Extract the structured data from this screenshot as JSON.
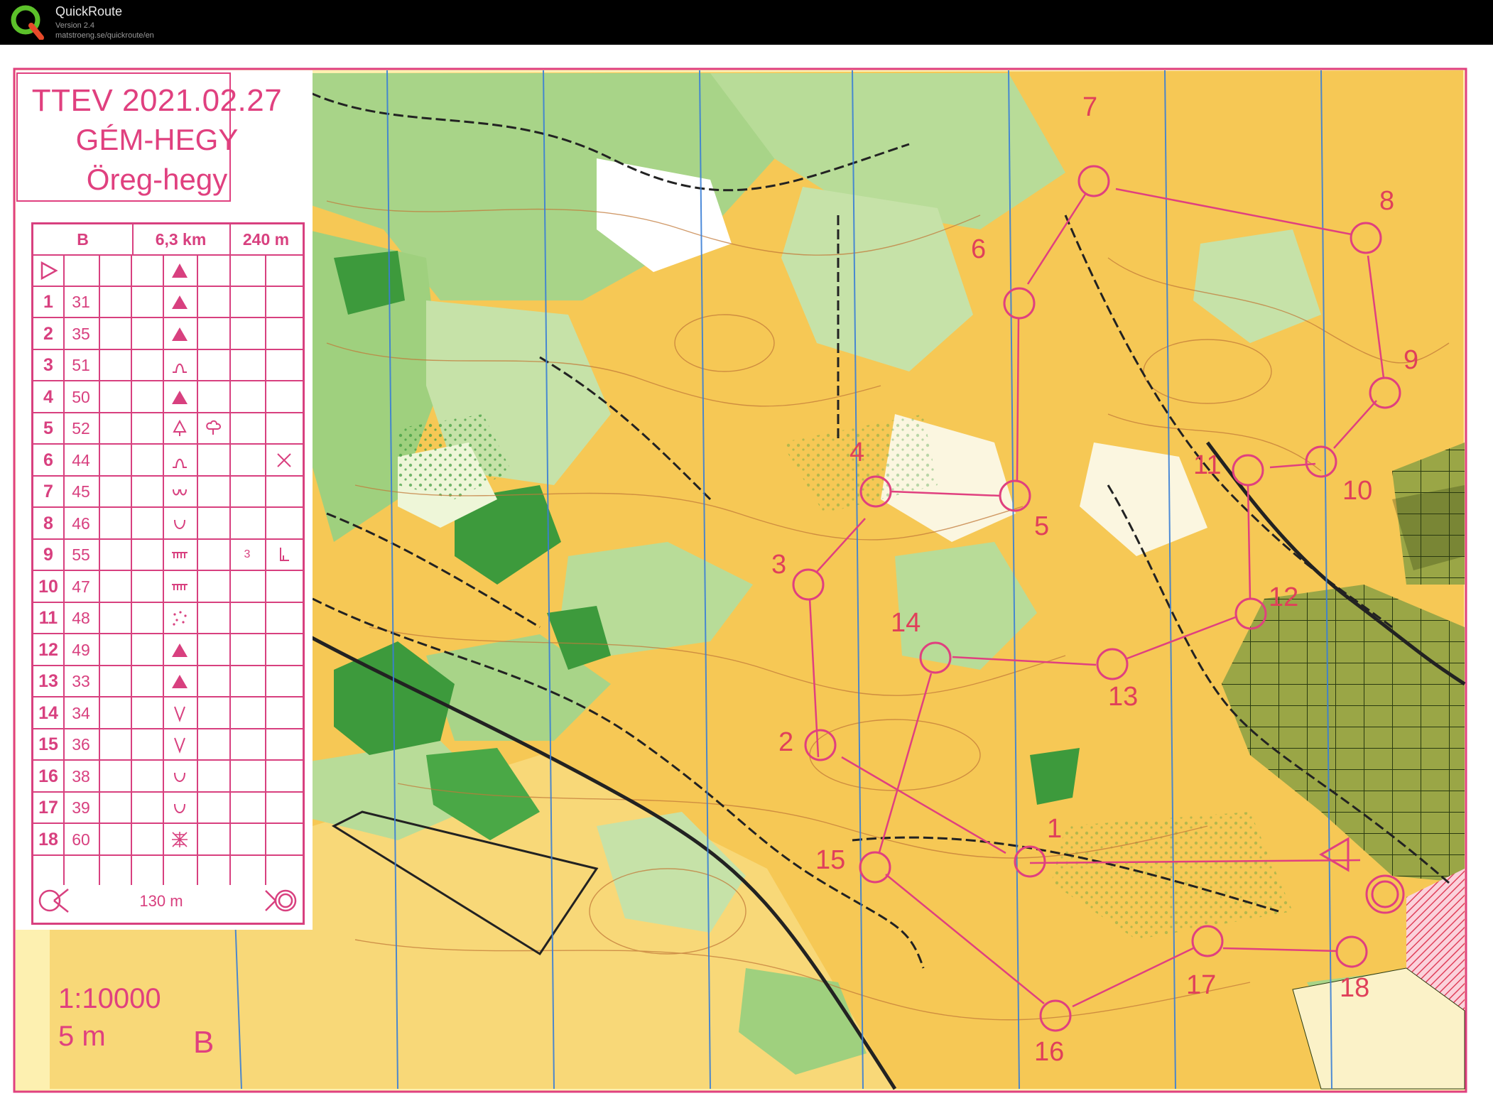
{
  "app": {
    "name": "QuickRoute",
    "version": "Version 2.4",
    "url": "matstroeng.se/quickroute/en"
  },
  "map": {
    "title_lines": [
      "TTEV 2021.02.27",
      "GÉM-HEGY",
      "Öreg-hegy"
    ],
    "scale": "1:10000",
    "contour_interval": "5 m",
    "course_letter": "B",
    "colors": {
      "course": "#e0407f",
      "open_land": "#f5c040",
      "rough_open": "#fbe08a",
      "forest_green": "#8cc26a",
      "dark_green": "#3d9a3c",
      "white_forest": "#ffffff",
      "north_lines": "#3a7fd6",
      "tracks": "#222222"
    },
    "controls": [
      {
        "label": "1"
      },
      {
        "label": "2"
      },
      {
        "label": "3"
      },
      {
        "label": "4"
      },
      {
        "label": "5"
      },
      {
        "label": "6"
      },
      {
        "label": "7"
      },
      {
        "label": "8"
      },
      {
        "label": "9"
      },
      {
        "label": "10"
      },
      {
        "label": "11"
      },
      {
        "label": "12"
      },
      {
        "label": "13"
      },
      {
        "label": "14"
      },
      {
        "label": "15"
      },
      {
        "label": "16"
      },
      {
        "label": "17"
      },
      {
        "label": "18"
      }
    ]
  },
  "description": {
    "header": {
      "course": "B",
      "length": "6,3 km",
      "climb": "240 m"
    },
    "start_symbol": "start-triangle-icon",
    "rows": [
      {
        "num": "1",
        "code": "31",
        "feature": "boulder-icon",
        "extra": "",
        "dim": "",
        "right": ""
      },
      {
        "num": "2",
        "code": "35",
        "feature": "boulder-icon",
        "extra": "",
        "dim": "",
        "right": ""
      },
      {
        "num": "3",
        "code": "51",
        "feature": "knoll-icon",
        "extra": "",
        "dim": "",
        "right": ""
      },
      {
        "num": "4",
        "code": "50",
        "feature": "boulder-icon",
        "extra": "",
        "dim": "",
        "right": ""
      },
      {
        "num": "5",
        "code": "52",
        "feature": "tree-icon",
        "extra": "bush-icon",
        "dim": "",
        "right": ""
      },
      {
        "num": "6",
        "code": "44",
        "feature": "knoll-icon",
        "extra": "",
        "dim": "",
        "right": "cross-icon"
      },
      {
        "num": "7",
        "code": "45",
        "feature": "pit-icon",
        "extra": "",
        "dim": "",
        "right": ""
      },
      {
        "num": "8",
        "code": "46",
        "feature": "depression-icon",
        "extra": "",
        "dim": "",
        "right": ""
      },
      {
        "num": "9",
        "code": "55",
        "feature": "cliff-icon",
        "extra": "",
        "dim": "3",
        "right": "foot-icon"
      },
      {
        "num": "10",
        "code": "47",
        "feature": "cliff-icon",
        "extra": "",
        "dim": "",
        "right": ""
      },
      {
        "num": "11",
        "code": "48",
        "feature": "stony-icon",
        "extra": "",
        "dim": "",
        "right": ""
      },
      {
        "num": "12",
        "code": "49",
        "feature": "boulder-icon",
        "extra": "",
        "dim": "",
        "right": ""
      },
      {
        "num": "13",
        "code": "33",
        "feature": "boulder-icon",
        "extra": "",
        "dim": "",
        "right": ""
      },
      {
        "num": "14",
        "code": "34",
        "feature": "gully-icon",
        "extra": "",
        "dim": "",
        "right": ""
      },
      {
        "num": "15",
        "code": "36",
        "feature": "gully-icon",
        "extra": "",
        "dim": "",
        "right": ""
      },
      {
        "num": "16",
        "code": "38",
        "feature": "depression-icon",
        "extra": "",
        "dim": "",
        "right": ""
      },
      {
        "num": "17",
        "code": "39",
        "feature": "depression-icon",
        "extra": "",
        "dim": "",
        "right": ""
      },
      {
        "num": "18",
        "code": "60",
        "feature": "ruin-icon",
        "extra": "",
        "dim": "",
        "right": ""
      }
    ],
    "footer": {
      "distance": "130 m"
    }
  }
}
